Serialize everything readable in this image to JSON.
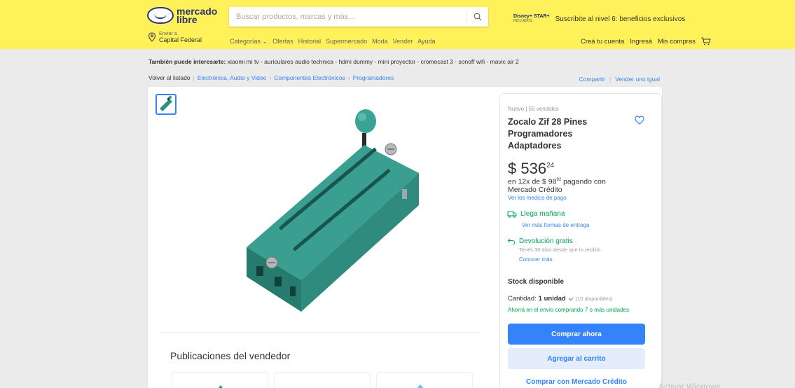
{
  "header": {
    "logo_line1": "mercado",
    "logo_line2": "libre",
    "search_placeholder": "Buscar productos, marcas y más…",
    "promo_logo_line1": "Disney+ STAR+",
    "promo_logo_line2": "INCLUIDOS",
    "promo_text": "Suscribite al nivel 6: beneficios exclusivos",
    "location_line1": "Enviar a",
    "location_line2": "Capital Federal",
    "nav": [
      "Categorías ⌄",
      "Ofertas",
      "Historial",
      "Supermercado",
      "Moda",
      "Vender",
      "Ayuda"
    ],
    "account": [
      "Creá tu cuenta",
      "Ingresá",
      "Mis compras"
    ]
  },
  "interest": {
    "label": "También puede interesarte:",
    "items": "xiaomi mi tv - auriculares audio technica - hdmi dummy - mini proyector - cromecast 3 - sonoff wifi - mavic air 2"
  },
  "breadcrumb": {
    "back": "Volver al listado",
    "items": [
      "Electrónica, Audio y Video",
      "Componentes Electrónicos",
      "Programadores"
    ],
    "share": "Compartir",
    "sell": "Vender uno igual"
  },
  "product": {
    "meta": "Nuevo  |  55 vendidos",
    "title": "Zocalo Zif 28 Pines Programadores Adaptadores",
    "price_int": "$ 536",
    "price_cents": "24",
    "install_prefix": "en 12x de $ 98",
    "install_cents": "92",
    "install_suffix": " pagando con Mercado Crédito",
    "payment_link": "Ver los medios de pago",
    "shipping": "Llega mañana",
    "shipping_more": "Ver más formas de entrega",
    "return": "Devolución gratis",
    "return_sub": "Tenés 30 días desde que lo recibís.",
    "return_more": "Conocer más",
    "stock": "Stock disponible",
    "qty_label": "Cantidad:",
    "qty_value": "1 unidad",
    "qty_available": "(10 disponibles)",
    "saving": "Ahorrá en el envío comprando 7 o más unidades",
    "buy_now": "Comprar ahora",
    "add_cart": "Agregar al carrito",
    "buy_credit": "Comprar con Mercado Crédito"
  },
  "seller": {
    "title": "Publicaciones del vendedor"
  },
  "watermark": "Activar Windows",
  "colors": {
    "header_bg": "#fff159",
    "accent": "#3483fa",
    "success": "#00a650",
    "page_bg": "#ebebeb",
    "product_teal": "#2f8f82"
  }
}
